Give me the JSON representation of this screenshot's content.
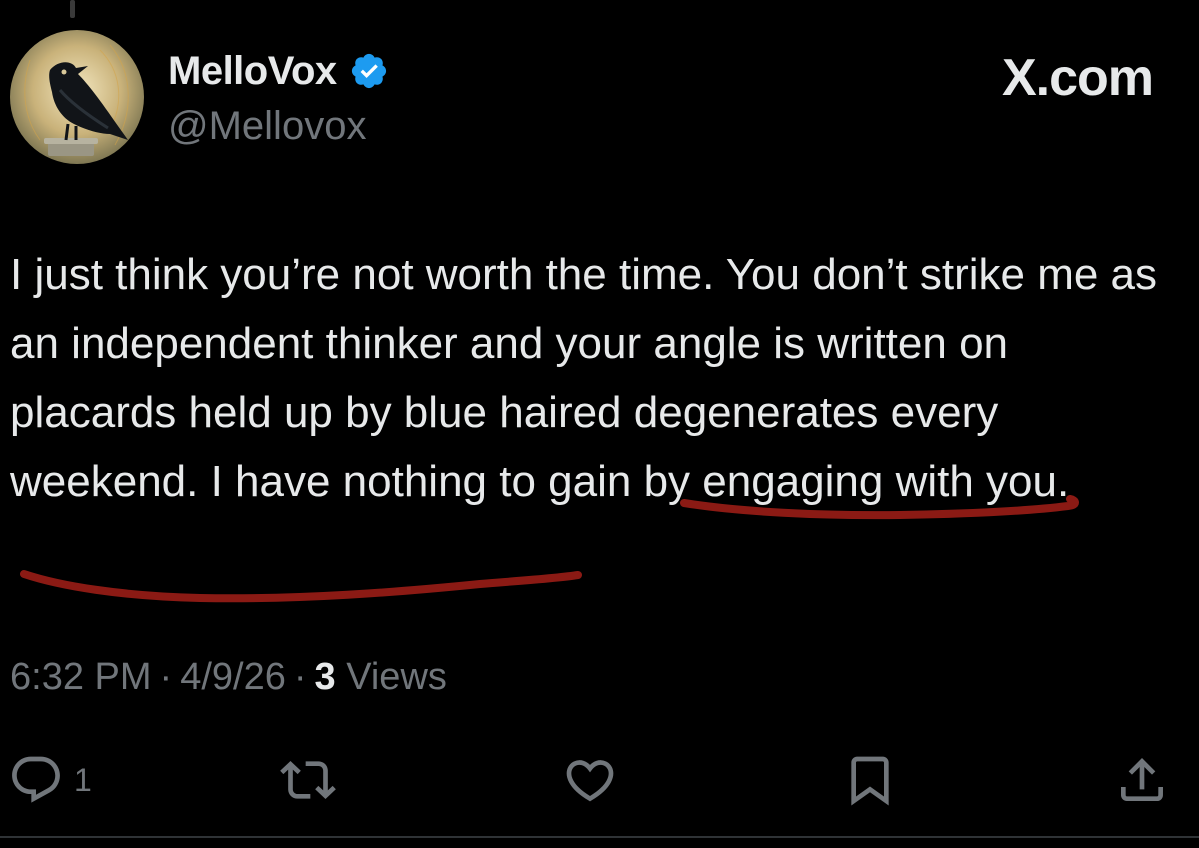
{
  "author": {
    "display_name": "MelloVox",
    "handle": "@Mellovox",
    "verified": true,
    "avatar_icon": "crow-avatar",
    "verified_color": "#1d9bf0"
  },
  "site_label": "X.com",
  "tweet": {
    "text": "I just think you’re not worth the time. You don’t strike me as an independent thinker and your angle is written on placards held up by blue haired degenerates every weekend. I have nothing to gain by engaging with you.",
    "highlighted_phrase": "have nothing to gain by engaging with you",
    "highlight_color": "#8b1a14"
  },
  "meta": {
    "time": "6:32 PM",
    "date": "4/9/26",
    "views_count": "3",
    "views_label": "Views",
    "separator": "·"
  },
  "actions": {
    "reply": {
      "icon": "reply-icon",
      "count": "1"
    },
    "retweet": {
      "icon": "retweet-icon",
      "count": ""
    },
    "like": {
      "icon": "heart-icon",
      "count": ""
    },
    "bookmark": {
      "icon": "bookmark-icon",
      "count": ""
    },
    "share": {
      "icon": "share-icon",
      "count": ""
    }
  },
  "colors": {
    "background": "#000000",
    "primary_text": "#e7e9ea",
    "secondary_text": "#71767b"
  }
}
